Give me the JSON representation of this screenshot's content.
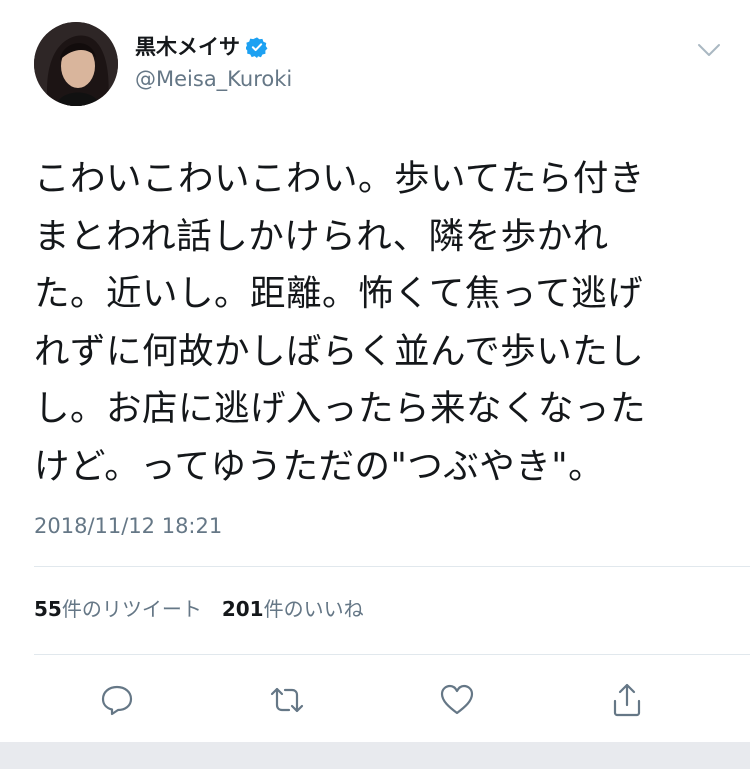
{
  "author": {
    "display_name": "黒木メイサ",
    "handle": "@Meisa_Kuroki",
    "verified": true
  },
  "tweet": {
    "text": "こわいこわいこわい。歩いてたら付き\nまとわれ話しかけられ、隣を歩かれ\nた。近いし。距離。怖くて焦って逃げ\nれずに何故かしばらく並んで歩いたし\nし。お店に逃げ入ったら来なくなった\nけど。ってゆうただの\"つぶやき\"。",
    "timestamp": "2018/11/12 18:21"
  },
  "stats": {
    "retweets_count": "55",
    "retweets_label": "件のリツイート",
    "likes_count": "201",
    "likes_label": "件のいいね"
  },
  "icons": {
    "verified": "verified-badge-icon",
    "menu": "chevron-down-icon",
    "reply": "reply-icon",
    "retweet": "retweet-icon",
    "like": "heart-icon",
    "share": "share-icon"
  },
  "colors": {
    "text": "#14171a",
    "secondary": "#657786",
    "verified": "#1da1f2",
    "divider": "#e1e8ed"
  }
}
